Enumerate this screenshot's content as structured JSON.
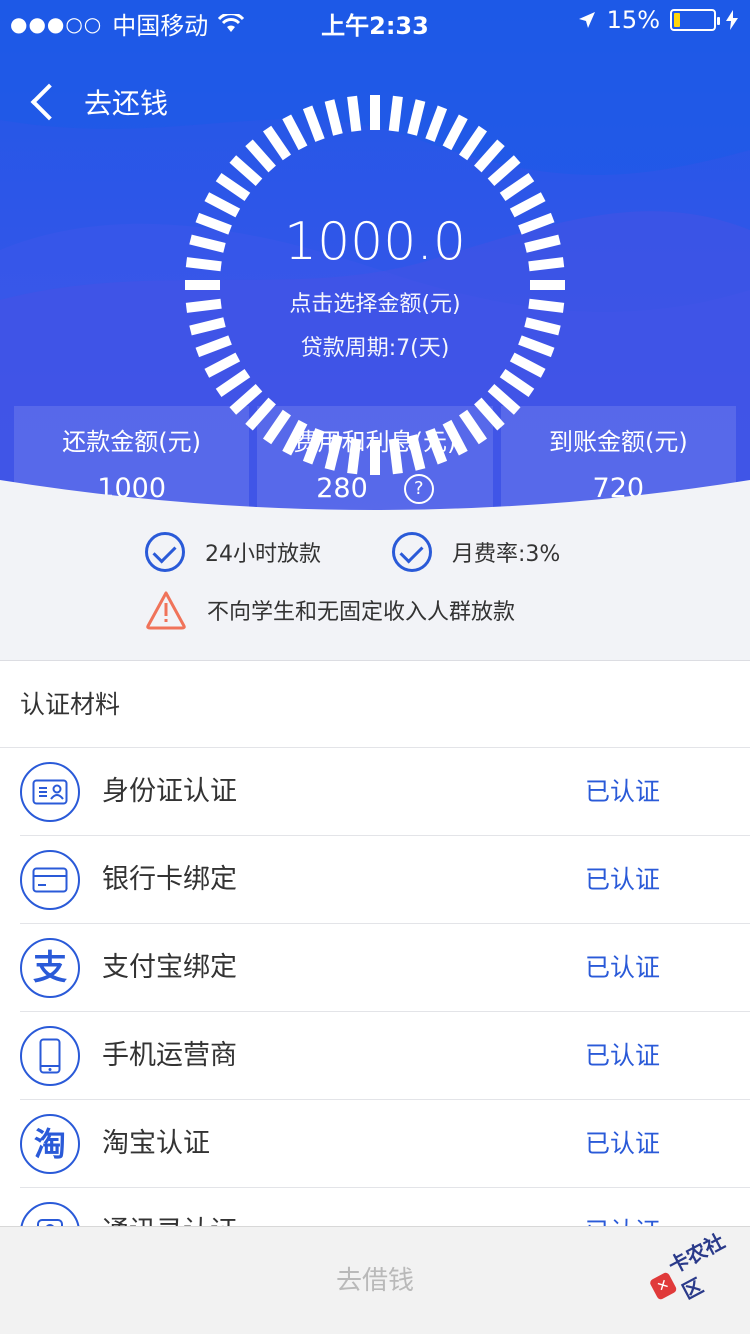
{
  "status_bar": {
    "signal": "●●●○○",
    "carrier": "中国移动",
    "time": "上午2:33",
    "battery_percent": "15%",
    "battery_level": 0.15
  },
  "nav": {
    "back_label": "去还钱"
  },
  "loan": {
    "amount": "1000.0",
    "amount_hint": "点击选择金额(元)",
    "period": "贷款周期:7(天)"
  },
  "stats": [
    {
      "label": "还款金额(元)",
      "value": "1000"
    },
    {
      "label": "费用和利息(元)",
      "value": "280"
    },
    {
      "label": "到账金额(元)",
      "value": "720"
    }
  ],
  "stats_help_mark": "?",
  "features": {
    "fast": "24小时放款",
    "rate": "月费率:3%",
    "warning": "不向学生和无固定收入人群放款"
  },
  "cert": {
    "title": "认证材料",
    "items": [
      {
        "name": "身份证认证",
        "status": "已认证",
        "icon": "id-card-icon"
      },
      {
        "name": "银行卡绑定",
        "status": "已认证",
        "icon": "bank-card-icon"
      },
      {
        "name": "支付宝绑定",
        "status": "已认证",
        "icon": "alipay-icon"
      },
      {
        "name": "手机运营商",
        "status": "已认证",
        "icon": "phone-icon"
      },
      {
        "name": "淘宝认证",
        "status": "已认证",
        "icon": "taobao-icon"
      },
      {
        "name": "通讯录认证",
        "status": "已认证",
        "icon": "contacts-icon"
      }
    ]
  },
  "bottom": {
    "borrow_label": "去借钱"
  },
  "watermark": {
    "text": "卡农社区"
  },
  "colors": {
    "primary": "#2a5ad8",
    "hero_top": "#1f58e6",
    "warning": "#f0735a"
  }
}
